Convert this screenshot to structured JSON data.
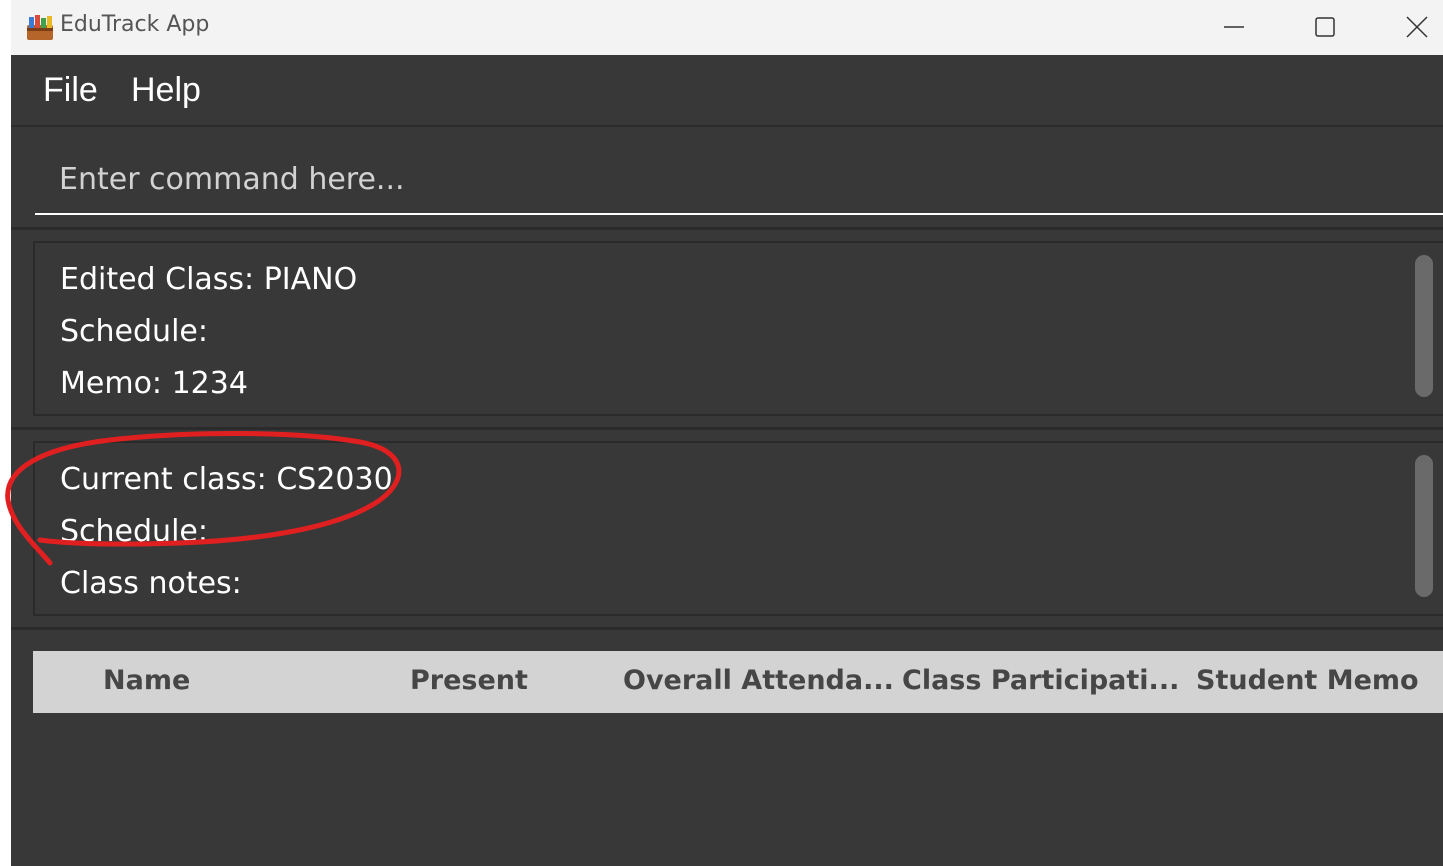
{
  "window": {
    "title": "EduTrack App",
    "app_icon": "books-app-icon",
    "controls": [
      "minimize-icon",
      "maximize-icon",
      "close-icon"
    ]
  },
  "menu": {
    "items": [
      {
        "label": "File"
      },
      {
        "label": "Help"
      }
    ]
  },
  "command_box": {
    "placeholder": "Enter command here...",
    "value": ""
  },
  "result_display": {
    "lines": [
      "Edited Class: PIANO",
      "Schedule:",
      "Memo: 1234"
    ]
  },
  "current_class": {
    "lines": [
      "Current class: CS2030",
      "Schedule:",
      "Class notes:"
    ]
  },
  "student_table": {
    "columns": [
      "Name",
      "Present",
      "Overall Attenda...",
      "Class Participati...",
      "Student Memo"
    ],
    "rows": []
  },
  "annotation": {
    "color": "#e02020",
    "shape": "hand-drawn-circle"
  }
}
